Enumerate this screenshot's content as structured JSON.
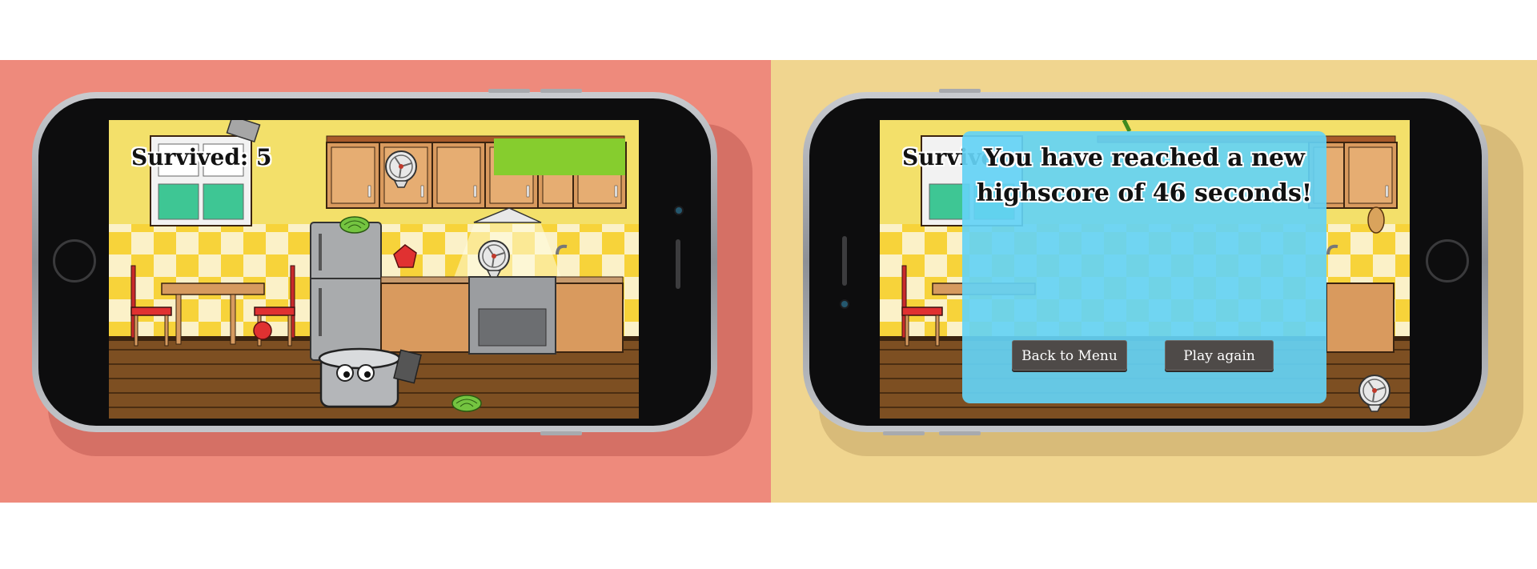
{
  "colors": {
    "left_bg": "#ee8a7c",
    "right_bg": "#f0d58f",
    "overlay": "#64d2f5",
    "progress_fill": "#86cd2e",
    "button_bg": "#4e4a48"
  },
  "left_screen": {
    "survived_text": "Survived: 5",
    "survival_bar_level": 1.0
  },
  "right_screen": {
    "survived_text_partial": "Survive",
    "highscore_message_line1": "You have reached a new",
    "highscore_message_line2": "highscore of 46 seconds!",
    "back_to_menu_label": "Back to Menu",
    "play_again_label": "Play again"
  },
  "icons": [
    "home-button-icon",
    "front-camera-icon",
    "speaker-grille-icon",
    "pot-player-icon",
    "fan-icon",
    "lettuce-icon",
    "tomato-icon",
    "potato-icon"
  ]
}
